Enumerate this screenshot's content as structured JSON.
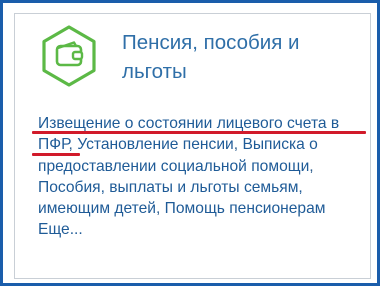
{
  "card": {
    "title_line1": "Пенсия, пособия и",
    "title_line2": "льготы",
    "icon": "wallet-icon",
    "accent_color": "#5cb946",
    "title_color": "#2f6fa8"
  },
  "links": [
    {
      "text": "Извещение о состоянии лицевого счета в ПФР"
    },
    {
      "text": "Установление пенсии"
    },
    {
      "text": "Выписка о предоставлении социальной помощи"
    },
    {
      "text": "Пособия, выплаты и льготы семьям, имеющим детей"
    },
    {
      "text": "Помощь пенсионерам"
    }
  ],
  "more_label": "Еще...",
  "highlight_color": "#d11a2a"
}
